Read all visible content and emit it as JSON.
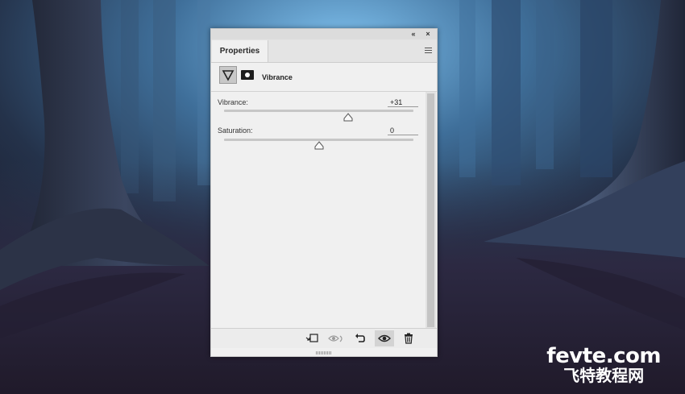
{
  "panel": {
    "title": "Properties",
    "collapse_glyph": "«",
    "close_glyph": "×",
    "menu_icon": "hamburger-icon"
  },
  "header": {
    "adjustment_icon": "vibrance-triangle-icon",
    "mask_icon": "layer-mask-icon",
    "title": "Vibrance"
  },
  "params": [
    {
      "label": "Vibrance:",
      "value": "+31",
      "slider_fraction": 0.656
    },
    {
      "label": "Saturation:",
      "value": "0",
      "slider_fraction": 0.5
    }
  ],
  "footer": {
    "buttons": [
      "clip-to-layer-icon",
      "view-previous-state-icon",
      "reset-icon",
      "visibility-eye-icon",
      "trash-icon"
    ]
  },
  "watermark": {
    "line1": "fevte.com",
    "line2": "飞特教程网"
  }
}
